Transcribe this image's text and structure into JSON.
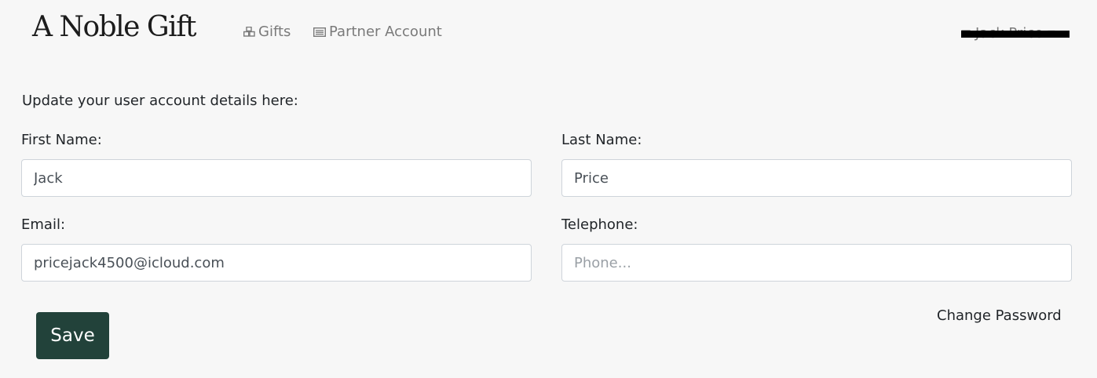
{
  "nav": {
    "brand": "A Noble Gift",
    "gifts": "Gifts",
    "partner_account": "Partner Account",
    "user_name": "Jack Price"
  },
  "icons": {
    "gifts": "gifts-icon",
    "partner_account": "id-card-icon",
    "user": "user-icon",
    "dropdown": "caret-down-icon"
  },
  "form": {
    "intro": "Update your user account details here:",
    "first_name_label": "First Name:",
    "first_name_value": "Jack",
    "last_name_label": "Last Name:",
    "last_name_value": "Price",
    "email_label": "Email:",
    "email_value": "pricejack4500@icloud.com",
    "telephone_label": "Telephone:",
    "telephone_placeholder": "Phone...",
    "telephone_value": "",
    "save_label": "Save",
    "change_password_label": "Change Password"
  },
  "colors": {
    "primary_button": "#22423a",
    "background": "#f7f7f7",
    "nav_link": "#7a7a7a"
  }
}
